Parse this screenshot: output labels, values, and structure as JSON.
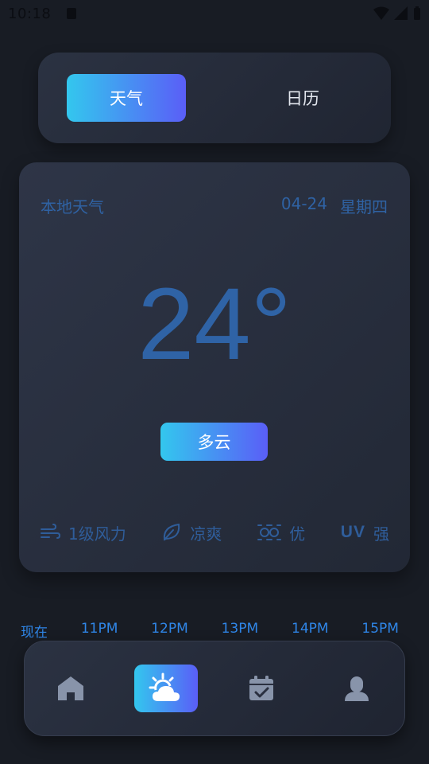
{
  "status_bar": {
    "time": "10:18"
  },
  "tabs": [
    {
      "label": "天气",
      "active": true
    },
    {
      "label": "日历",
      "active": false
    }
  ],
  "weather_card": {
    "location_label": "本地天气",
    "date": "04-24",
    "weekday": "星期四",
    "temperature": "24°",
    "condition": "多云",
    "metrics": {
      "wind": "1级风力",
      "feel": "凉爽",
      "air_quality": "优",
      "uv_label": "UV",
      "uv": "强"
    }
  },
  "hourly": {
    "labels": [
      "现在",
      "11PM",
      "12PM",
      "13PM",
      "14PM",
      "15PM"
    ]
  },
  "bottom_nav": {
    "items": [
      {
        "icon": "home-icon",
        "active": false
      },
      {
        "icon": "partly-cloudy-icon",
        "active": true
      },
      {
        "icon": "calendar-check-icon",
        "active": false
      },
      {
        "icon": "user-icon",
        "active": false
      }
    ]
  },
  "colors": {
    "background": "#181c24",
    "accent_start": "#33c7ee",
    "accent_end": "#5a5ef7",
    "muted_blue": "#2f62a3",
    "hour_blue": "#2f86e8"
  }
}
